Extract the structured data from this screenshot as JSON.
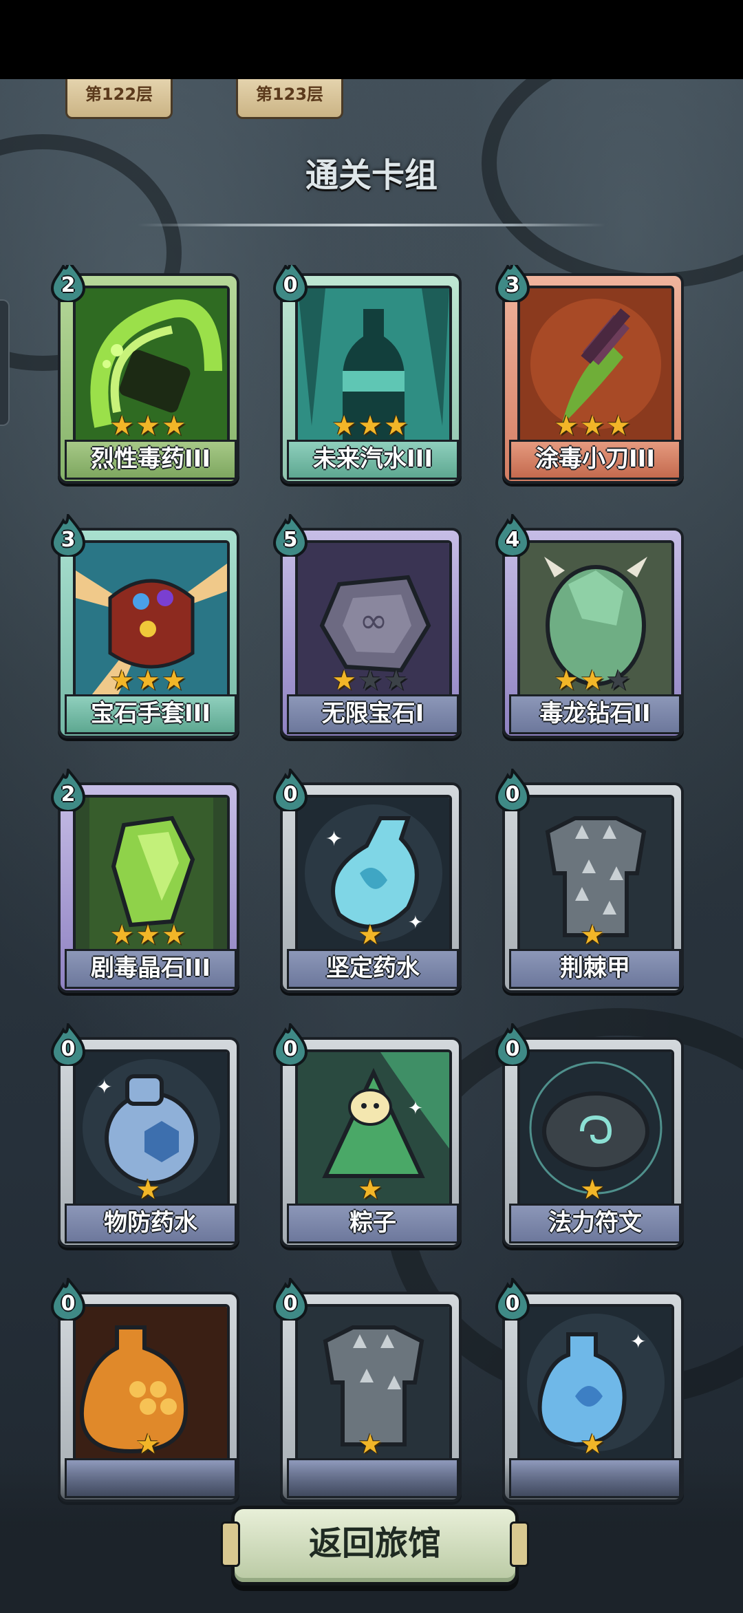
{
  "floor_tabs": [
    "第122层",
    "第123层"
  ],
  "title": "通关卡组",
  "cards": [
    {
      "name": "烈性毒药III",
      "cost": "2",
      "stars": 3,
      "max_stars": 3
    },
    {
      "name": "未来汽水III",
      "cost": "0",
      "stars": 3,
      "max_stars": 3
    },
    {
      "name": "涂毒小刀III",
      "cost": "3",
      "stars": 3,
      "max_stars": 3
    },
    {
      "name": "宝石手套III",
      "cost": "3",
      "stars": 3,
      "max_stars": 3
    },
    {
      "name": "无限宝石I",
      "cost": "5",
      "stars": 1,
      "max_stars": 3
    },
    {
      "name": "毒龙钻石II",
      "cost": "4",
      "stars": 2,
      "max_stars": 3
    },
    {
      "name": "剧毒晶石III",
      "cost": "2",
      "stars": 3,
      "max_stars": 3
    },
    {
      "name": "坚定药水",
      "cost": "0",
      "stars": 1,
      "max_stars": 1
    },
    {
      "name": "荆棘甲",
      "cost": "0",
      "stars": 1,
      "max_stars": 1
    },
    {
      "name": "物防药水",
      "cost": "0",
      "stars": 1,
      "max_stars": 1
    },
    {
      "name": "粽子",
      "cost": "0",
      "stars": 1,
      "max_stars": 1
    },
    {
      "name": "法力符文",
      "cost": "0",
      "stars": 1,
      "max_stars": 1
    },
    {
      "name": "",
      "cost": "0",
      "stars": 1,
      "max_stars": 1
    },
    {
      "name": "",
      "cost": "0",
      "stars": 1,
      "max_stars": 1
    },
    {
      "name": "",
      "cost": "0",
      "stars": 1,
      "max_stars": 1
    }
  ],
  "back_button": "返回旅馆",
  "colors": {
    "star": "#f2b628",
    "cost_badge": "#3f8a86",
    "button": "#dfe8cf"
  }
}
